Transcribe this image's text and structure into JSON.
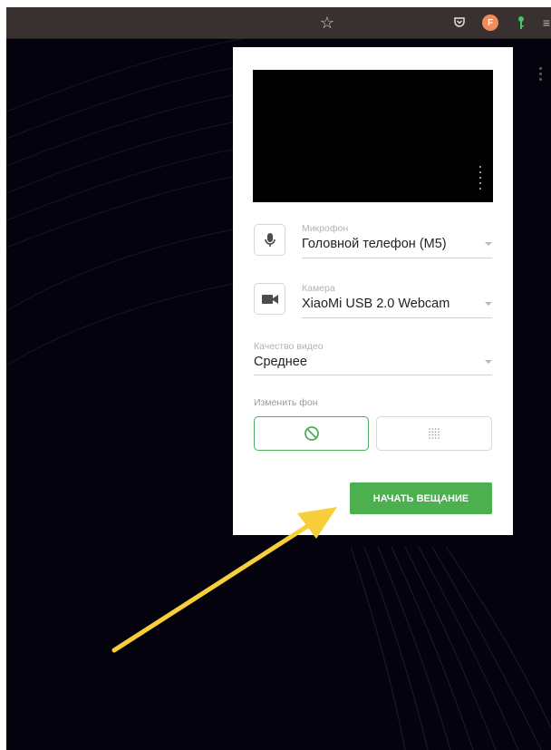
{
  "toolbar": {
    "icons": [
      "bookmark-star-icon",
      "pocket-icon",
      "profile-avatar",
      "password-key-icon",
      "menu-icon"
    ],
    "avatar_letter": "F"
  },
  "panel": {
    "microphone": {
      "label": "Микрофон",
      "value": "Головной телефон (M5)"
    },
    "camera": {
      "label": "Камера",
      "value": "XiaoMi USB 2.0 Webcam"
    },
    "quality": {
      "label": "Качество видео",
      "value": "Среднее"
    },
    "background": {
      "label": "Изменить фон",
      "options": [
        "none",
        "blur"
      ],
      "selected": "none"
    },
    "start_button": "НАЧАТЬ ВЕЩАНИЕ"
  },
  "colors": {
    "accent": "#4caf50",
    "arrow": "#f7cf3a",
    "background": "#04020d",
    "toolbar": "#38312f"
  }
}
